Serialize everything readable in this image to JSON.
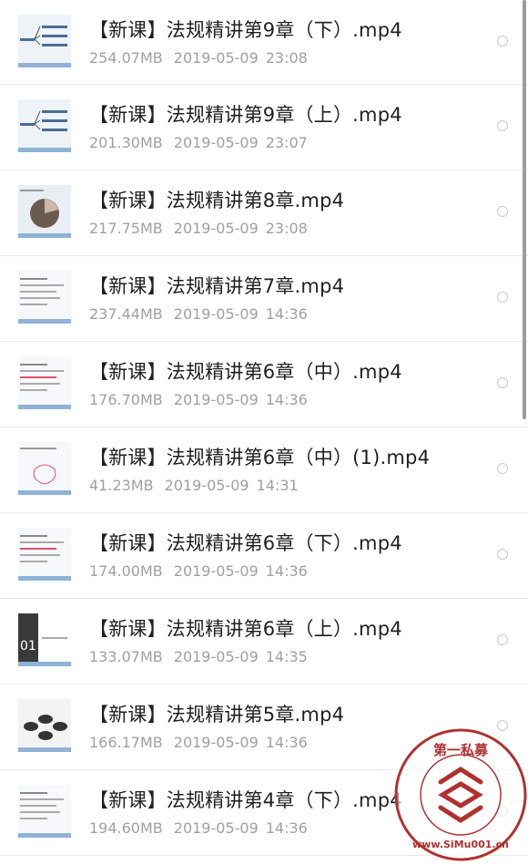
{
  "files": [
    {
      "title": "【新课】法规精讲第9章（下）.mp4",
      "size": "254.07MB",
      "date": "2019-05-09",
      "time": "23:08",
      "thumb": "flowchart"
    },
    {
      "title": "【新课】法规精讲第9章（上）.mp4",
      "size": "201.30MB",
      "date": "2019-05-09",
      "time": "23:07",
      "thumb": "mindmap"
    },
    {
      "title": "【新课】法规精讲第8章.mp4",
      "size": "217.75MB",
      "date": "2019-05-09",
      "time": "23:08",
      "thumb": "pie"
    },
    {
      "title": "【新课】法规精讲第7章.mp4",
      "size": "237.44MB",
      "date": "2019-05-09",
      "time": "14:36",
      "thumb": "text"
    },
    {
      "title": "【新课】法规精讲第6章（中）.mp4",
      "size": "176.70MB",
      "date": "2019-05-09",
      "time": "14:36",
      "thumb": "text-red"
    },
    {
      "title": "【新课】法规精讲第6章（中）(1).mp4",
      "size": "41.23MB",
      "date": "2019-05-09",
      "time": "14:31",
      "thumb": "sketch"
    },
    {
      "title": "【新课】法规精讲第6章（下）.mp4",
      "size": "174.00MB",
      "date": "2019-05-09",
      "time": "14:36",
      "thumb": "text-red"
    },
    {
      "title": "【新课】法规精讲第6章（上）.mp4",
      "size": "133.07MB",
      "date": "2019-05-09",
      "time": "14:35",
      "thumb": "cover"
    },
    {
      "title": "【新课】法规精讲第5章.mp4",
      "size": "166.17MB",
      "date": "2019-05-09",
      "time": "14:36",
      "thumb": "circles"
    },
    {
      "title": "【新课】法规精讲第4章（下）.mp4",
      "size": "194.60MB",
      "date": "2019-05-09",
      "time": "14:36",
      "thumb": "text"
    }
  ],
  "watermark": {
    "text_top": "第一私募",
    "text_bottom": "www.SiMu001.cn",
    "color": "#b0312f"
  }
}
